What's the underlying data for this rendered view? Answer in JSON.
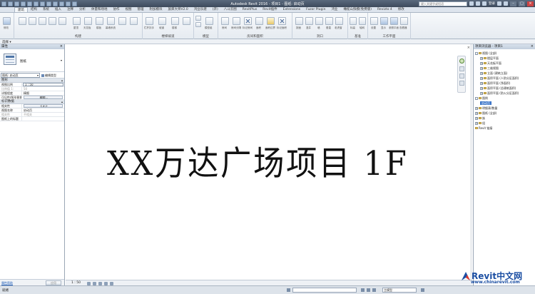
{
  "app": {
    "title": "Autodesk Revit 2016 -    项目1 - 图纸: 启动页",
    "search_placeholder": "键入关键字或短语",
    "login_label": "登录"
  },
  "ribbon_tabs": [
    {
      "label": "建筑",
      "active": true
    },
    {
      "label": "结构"
    },
    {
      "label": "系统"
    },
    {
      "label": "插入"
    },
    {
      "label": "注释"
    },
    {
      "label": "分析"
    },
    {
      "label": "体量和场地"
    },
    {
      "label": "协作"
    },
    {
      "label": "视图"
    },
    {
      "label": "管理"
    },
    {
      "label": "附加模块"
    },
    {
      "label": "族库大师V2.0"
    },
    {
      "label": "鸿业乐建"
    },
    {
      "label": "(开)"
    },
    {
      "label": "八斗云图"
    },
    {
      "label": "RevitPlus"
    },
    {
      "label": "Revit插件"
    },
    {
      "label": "Extensions"
    },
    {
      "label": "Fuzor Plugin"
    },
    {
      "label": "鸿业"
    },
    {
      "label": "橄榄山快模(免费版)"
    },
    {
      "label": "Revizto 4"
    },
    {
      "label": "修改"
    }
  ],
  "ribbon_panels": [
    {
      "title": "选择"
    },
    {
      "title": "构建"
    },
    {
      "title": "楼梯坡道"
    },
    {
      "title": "模型"
    },
    {
      "title": "房间和面积"
    },
    {
      "title": "洞口"
    },
    {
      "title": "基准"
    },
    {
      "title": "工作平面"
    }
  ],
  "ribbon_buttons": {
    "modify": "修改",
    "roof": "屋顶",
    "ceiling": "天花板",
    "floor": "楼板",
    "curtain_system": "幕墙系统",
    "railing": "栏杆扶手",
    "ramp": "坡道",
    "stair": "楼梯",
    "model_text": "模型文字",
    "model_line": "模型线",
    "model_group": "模型组",
    "room": "房间",
    "room_separator": "房间分隔",
    "tag_room": "标记房间",
    "area": "面积",
    "area_boundary": "面积边界",
    "tag_area": "标记面积",
    "by_face": "按面",
    "shaft": "竖井",
    "wall": "墙",
    "vertical": "垂直",
    "dormer": "老虎窗",
    "level": "标高",
    "grid": "轴网",
    "set": "设置",
    "show": "显示",
    "ref_plane": "参照平面",
    "viewer": "查看器"
  },
  "option_bar": {
    "label": "选择 ▾"
  },
  "properties": {
    "title": "属性",
    "type_name": "图纸",
    "filter_value": "图纸: 启动页",
    "edit_type": "编辑类型",
    "sections": [
      {
        "name": "图形",
        "rows": [
          {
            "k": "视图比例",
            "v": "1 : 50",
            "style": "box"
          },
          {
            "k": "比例值 1:",
            "v": "50",
            "style": "dim"
          },
          {
            "k": "详细程度",
            "v": "精细"
          },
          {
            "k": "可见性/图形替换",
            "v": "编辑...",
            "style": "btn"
          }
        ]
      },
      {
        "name": "标识数据",
        "rows": [
          {
            "k": "相关性",
            "v": "<无>",
            "style": "btn"
          },
          {
            "k": "视图名称",
            "v": "启动页"
          },
          {
            "k": "相关性",
            "v": "不相关",
            "style": "dim"
          },
          {
            "k": "图纸上的标题",
            "v": ""
          }
        ]
      }
    ],
    "help_link": "属性帮助",
    "apply_label": "应用"
  },
  "canvas": {
    "main_text": "XX万达广场项目 1F",
    "view_scale": "1 : 50"
  },
  "browser": {
    "title": "项目浏览器 - 项目1",
    "tree": [
      {
        "label": "视图 (全部)",
        "level": 0,
        "exp": "-"
      },
      {
        "label": "楼层平面",
        "level": 1,
        "exp": "+"
      },
      {
        "label": "天花板平面",
        "level": 1,
        "exp": "+"
      },
      {
        "label": "三维视图",
        "level": 1,
        "exp": "+"
      },
      {
        "label": "立面 (建筑立面)",
        "level": 1,
        "exp": "+"
      },
      {
        "label": "面积平面 (人防分区面积)",
        "level": 1,
        "exp": "+"
      },
      {
        "label": "面积平面 (净面积)",
        "level": 1,
        "exp": "+"
      },
      {
        "label": "面积平面 (总建筑面积)",
        "level": 1,
        "exp": "+"
      },
      {
        "label": "面积平面 (防火分区面积)",
        "level": 1,
        "exp": "+"
      },
      {
        "label": "图例",
        "level": 0,
        "exp": "-"
      },
      {
        "label": "启动页",
        "level": 1,
        "selected": true
      },
      {
        "label": "明细表/数量",
        "level": 0,
        "exp": "+"
      },
      {
        "label": "图纸 (全部)",
        "level": 0,
        "exp": "+"
      },
      {
        "label": "族",
        "level": 0,
        "exp": "+"
      },
      {
        "label": "组",
        "level": 0,
        "exp": "+"
      },
      {
        "label": "Revit 链接",
        "level": 0,
        "link": true
      }
    ]
  },
  "statusbar": {
    "text": "就绪",
    "workset_value": "",
    "model_value": "主模型"
  },
  "watermark": {
    "logo_latin": "Revit",
    "logo_cn": "中文网",
    "url": "www.chinarevit.com"
  }
}
